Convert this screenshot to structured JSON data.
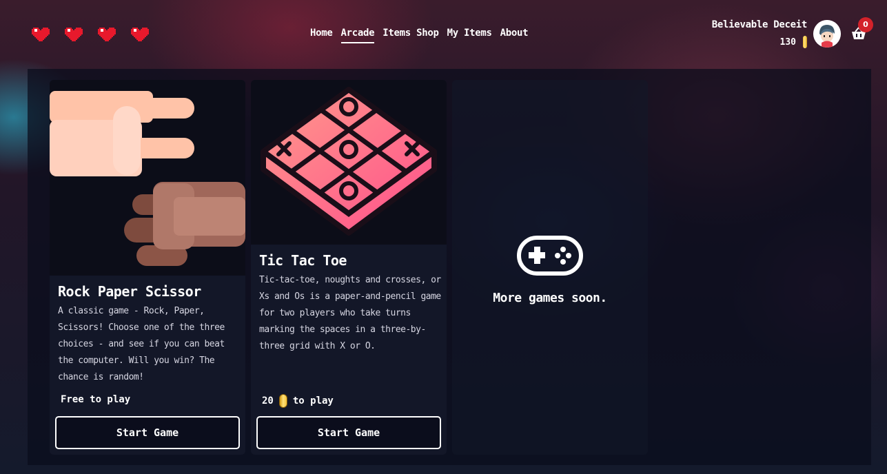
{
  "header": {
    "hearts": [
      "heart-icon",
      "heart-icon",
      "heart-icon",
      "heart-icon"
    ],
    "nav": [
      {
        "label": "Home",
        "active": false
      },
      {
        "label": "Arcade",
        "active": true
      },
      {
        "label": "Items Shop",
        "active": false
      },
      {
        "label": "My Items",
        "active": false
      },
      {
        "label": "About",
        "active": false
      }
    ],
    "user": {
      "name": "Believable Deceit",
      "coins": "130"
    },
    "cart": {
      "count": "0",
      "icon": "basket-icon"
    }
  },
  "games": [
    {
      "title": "Rock Paper Scissor",
      "description": "A classic game - Rock, Paper, Scissors! Choose one of the three choices - and see if you can beat the computer. Will you win? The chance is random!",
      "price_label": "Free to play",
      "button": "Start Game",
      "image_icon": "rock-paper-scissors-hands-icon"
    },
    {
      "title": "Tic Tac Toe",
      "description": "Tic-tac-toe, noughts and crosses, or Xs and Os is a paper-and-pencil game for two players who take turns marking the spaces in a three-by-three grid with X or O.",
      "price_amount": "20",
      "price_suffix": "to play",
      "button": "Start Game",
      "image_icon": "tic-tac-toe-board-icon"
    }
  ],
  "placeholder": {
    "text": "More games soon.",
    "icon": "gamepad-icon"
  },
  "colors": {
    "accent_pink": "#ff4f8b",
    "heart_red": "#e8192c",
    "badge_red": "#d3222a",
    "coin_gold": "#f5c33b"
  }
}
